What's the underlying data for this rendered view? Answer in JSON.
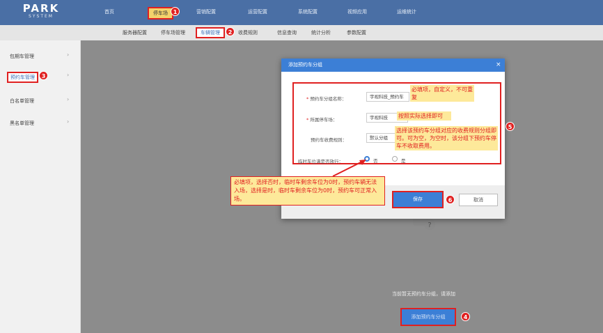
{
  "app": {
    "logo_main": "PARK",
    "logo_sub": "SYSTEM"
  },
  "topnav": {
    "items": [
      "首页",
      "停车场",
      "营销配置",
      "运营配置",
      "系统配置",
      "视频应用",
      "运维统计"
    ]
  },
  "subnav": {
    "items": [
      "服务器配置",
      "停车场管理",
      "车辆管理",
      "收费规则",
      "信息查询",
      "统计分析",
      "参数配置"
    ]
  },
  "sidebar": {
    "items": [
      "包期车管理",
      "预约车管理",
      "白名单管理",
      "黑名单管理"
    ]
  },
  "dialog": {
    "title": "添加预约车分组",
    "close": "×",
    "fields": {
      "group_name_label": "预约车分组名称：",
      "group_name_value": "宇视科技_预约车",
      "park_label": "所属停车场：",
      "park_value": "宇视科技",
      "rule_label": "预约车收费规则：",
      "rule_value": "默认分组",
      "temp_label": "临时车位满是否放行：",
      "temp_opt_no": "否",
      "temp_opt_yes": "是"
    },
    "save_label": "保存",
    "cancel_label": "取消"
  },
  "annotations": {
    "n1": "1",
    "n2": "2",
    "n3": "3",
    "n4": "4",
    "n5": "5",
    "n6": "6",
    "note_required": "必填项，自定义，不可重复",
    "note_park": "按照实际选择即可",
    "note_rule": "选择该预约车分组对应的收费规则分组即可。可为空，为空时，该分组下预约车停车不收取费用。",
    "note_temp": "必填项，选择否时，临时车剩余车位为0时，预约车辆无法入场，选择是时，临时车剩余车位为0时，预约车可正常入场。"
  },
  "main": {
    "empty_text": "当前暂无预约车分组，请添加",
    "add_label": "添加预约车分组"
  },
  "colors": {
    "accent": "#3c7fd6",
    "highlight": "#e02020",
    "note_bg": "#fde99a",
    "topbar": "#4a6fa5"
  }
}
